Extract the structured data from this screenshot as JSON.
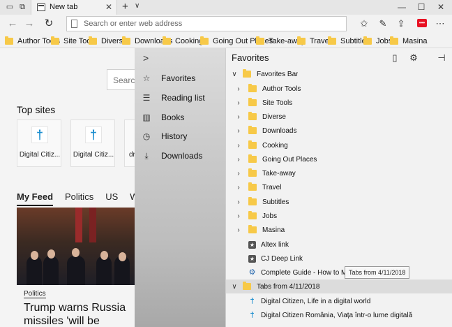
{
  "titlebar": {
    "tab_title": "New tab",
    "tab_close": "✕",
    "new_tab": "+",
    "tab_dropdown": "∨",
    "minimize": "—",
    "maximize": "☐",
    "close": "✕"
  },
  "addressbar": {
    "back": "←",
    "forward": "→",
    "refresh": "↻",
    "placeholder": "Search or enter web address",
    "extension_label": "•••"
  },
  "favorites_bar": {
    "items": [
      {
        "label": "Author Tools"
      },
      {
        "label": "Site Tools"
      },
      {
        "label": "Diverse"
      },
      {
        "label": "Downloads"
      },
      {
        "label": "Cooking"
      },
      {
        "label": "Going Out Places"
      },
      {
        "label": "Take-away"
      },
      {
        "label": "Travel"
      },
      {
        "label": "Subtitles"
      },
      {
        "label": "Jobs"
      },
      {
        "label": "Masina"
      }
    ]
  },
  "newtab": {
    "search_placeholder": "Search t",
    "top_sites_heading": "Top sites",
    "top_sites": [
      {
        "label": "Digital Citiz..."
      },
      {
        "label": "Digital Citiz..."
      },
      {
        "label": "dri"
      }
    ],
    "feed_tabs": [
      {
        "label": "My Feed"
      },
      {
        "label": "Politics"
      },
      {
        "label": "US"
      },
      {
        "label": "Wo"
      }
    ],
    "news_category": "Politics",
    "news_headline": "Trump warns Russia missiles 'will be coming'"
  },
  "hub": {
    "expand_chevron": ">",
    "nav": [
      {
        "label": "Favorites",
        "icon": "star-icon"
      },
      {
        "label": "Reading list",
        "icon": "reading-list-icon"
      },
      {
        "label": "Books",
        "icon": "books-icon"
      },
      {
        "label": "History",
        "icon": "history-icon"
      },
      {
        "label": "Downloads",
        "icon": "download-icon"
      }
    ],
    "pane_title": "Favorites",
    "favorites_bar_label": "Favorites Bar",
    "folders": [
      {
        "label": "Author Tools"
      },
      {
        "label": "Site Tools"
      },
      {
        "label": "Diverse"
      },
      {
        "label": "Downloads"
      },
      {
        "label": "Cooking"
      },
      {
        "label": "Going Out Places"
      },
      {
        "label": "Take-away"
      },
      {
        "label": "Travel"
      },
      {
        "label": "Subtitles"
      },
      {
        "label": "Jobs"
      },
      {
        "label": "Masina"
      }
    ],
    "links": [
      {
        "label": "Altex link",
        "icon": "star-link-icon"
      },
      {
        "label": "CJ Deep Link",
        "icon": "star-link-icon"
      },
      {
        "label": "Complete Guide - How to Migrate",
        "icon": "gear-page-icon"
      }
    ],
    "tabs_folder_label": "Tabs from 4/11/2018",
    "tabs_links": [
      {
        "label": "Digital Citizen, Life in a digital world"
      },
      {
        "label": "Digital Citizen România, Viața într-o lume digitală"
      }
    ],
    "tooltip": "Tabs from 4/11/2018"
  },
  "colors": {
    "folder": "#f7c948",
    "accent_blue": "#1b8ecf",
    "extension_red": "#e81123"
  }
}
